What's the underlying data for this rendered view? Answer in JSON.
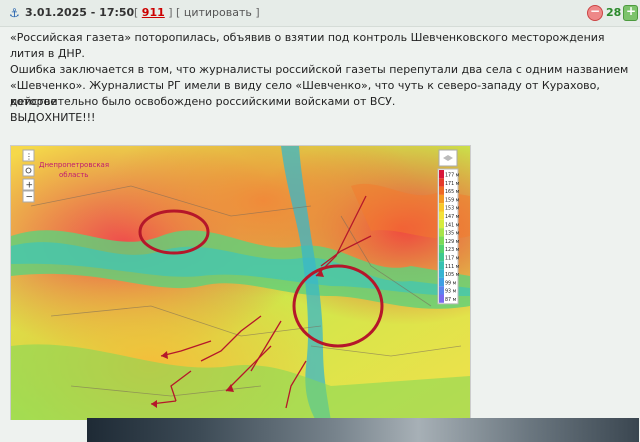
{
  "post": {
    "date": "3.01.2025 - 17:50",
    "id_number": "911",
    "quote_label": "цитировать",
    "rating": "28"
  },
  "content": {
    "p1": "«Российская газета» поторопилась, объявив о взятии под контроль Шевченковского месторождения лития в ДНР.",
    "p2_line1": "Ошибка заключается в том, что журналисты российской газеты перепутали два села с одним названием",
    "p2_line2": "«Шевченко». Журналисты РГ имели в виду село «Шевченко», что чуть к северо-западу от Курахово, которое",
    "p2_line3": "действительно было освобождено российскими войсками от ВСУ.",
    "p3": "ВЫДОХНИТЕ!!!"
  },
  "map": {
    "region_label_line1": "Днепропетровская",
    "region_label_line2": "область",
    "legend_values": [
      "177 м",
      "171 м",
      "165 м",
      "159 м",
      "153 м",
      "147 м",
      "141 м",
      "135 м",
      "129 м",
      "123 м",
      "117 м",
      "111 м",
      "105 м",
      "99 м",
      "93 м",
      "87 м"
    ],
    "legend_colors": [
      "#d9173a",
      "#e53a2a",
      "#ef6a24",
      "#f49a23",
      "#f8c72a",
      "#f5e23a",
      "#d6ec3e",
      "#a8e44a",
      "#7cdb57",
      "#55d26f",
      "#3fc98f",
      "#37c2b2",
      "#36b4d2",
      "#3f9fe4",
      "#5b84ee",
      "#7a6af0"
    ],
    "zoom_in": "+",
    "zoom_out": "−",
    "marker_colors": {
      "circle": "#b5172a",
      "arrows": "#b5172a"
    }
  }
}
